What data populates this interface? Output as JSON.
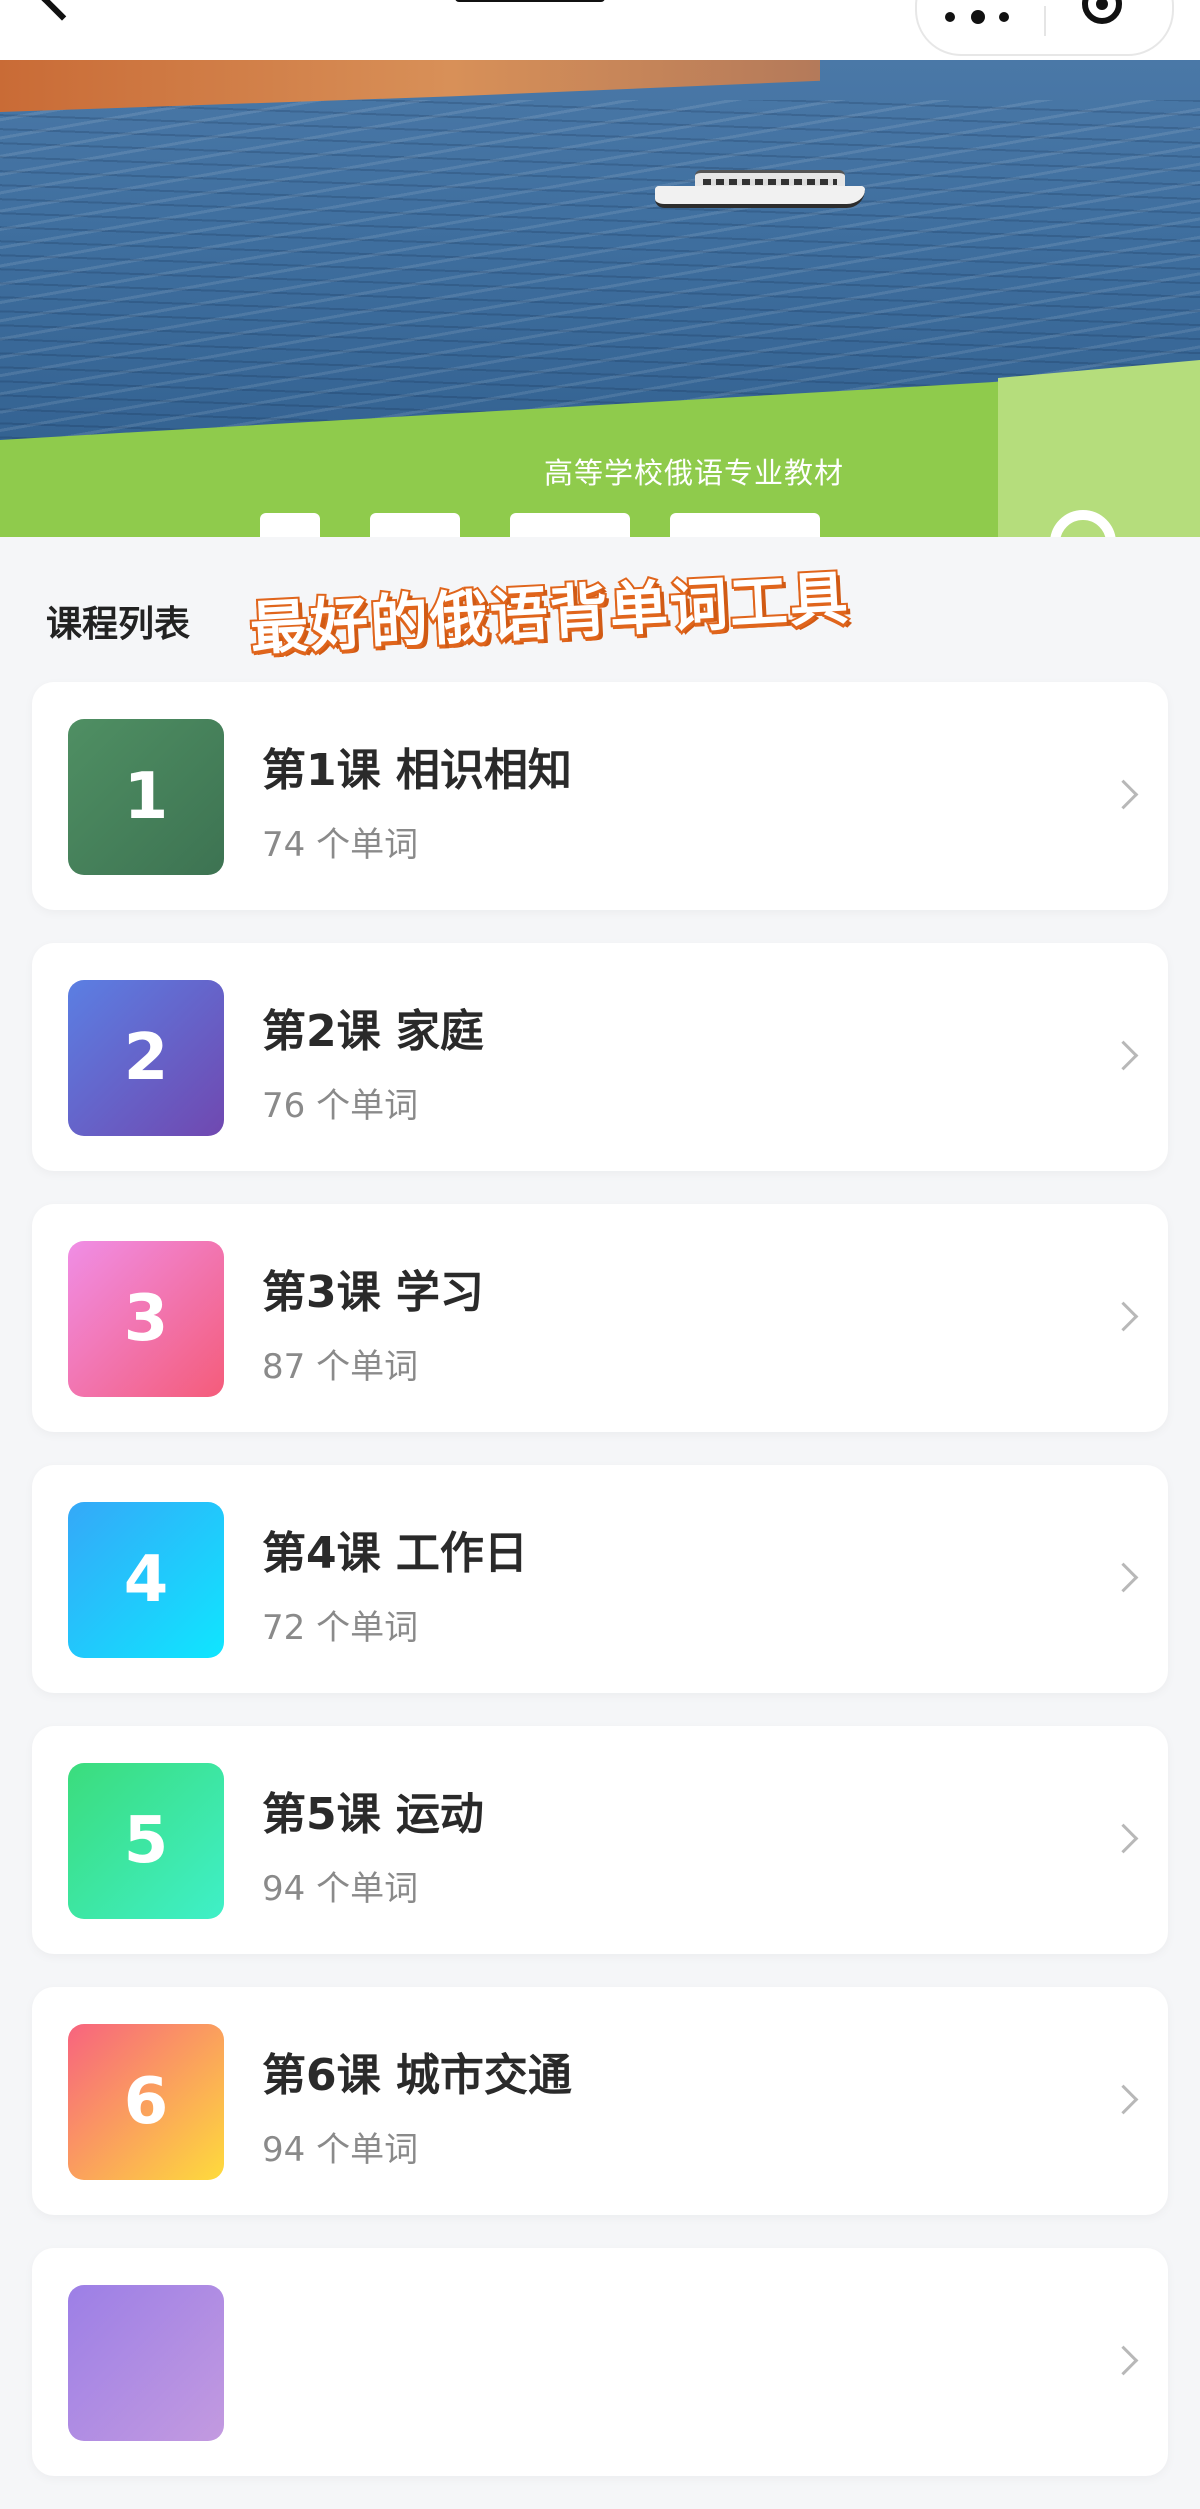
{
  "banner": {
    "subtitle": "高等学校俄语专业教材"
  },
  "section": {
    "title": "课程列表",
    "slogan": "最好的俄语背单词工具"
  },
  "courses": [
    {
      "number": "1",
      "title": "第1课  相识相知",
      "count": "74 个单词",
      "gradient": [
        "#4f8f63",
        "#3d7352"
      ]
    },
    {
      "number": "2",
      "title": "第2课  家庭",
      "count": "76 个单词",
      "gradient": [
        "#5b7fe3",
        "#7048b0"
      ]
    },
    {
      "number": "3",
      "title": "第3课  学习",
      "count": "87 个单词",
      "gradient": [
        "#f08ee6",
        "#f45c7a"
      ]
    },
    {
      "number": "4",
      "title": "第4课  工作日",
      "count": "72 个单词",
      "gradient": [
        "#35a8f8",
        "#0fe6ff"
      ]
    },
    {
      "number": "5",
      "title": "第5课  运动",
      "count": "94 个单词",
      "gradient": [
        "#3bdc7c",
        "#3ff0c8"
      ]
    },
    {
      "number": "6",
      "title": "第6课  城市交通",
      "count": "94 个单词",
      "gradient": [
        "#f7637f",
        "#fedb3c"
      ]
    },
    {
      "number": "",
      "title": "",
      "count": "",
      "gradient": [
        "#9c7fe6",
        "#c39ae0"
      ]
    }
  ],
  "icons": {
    "back": "back-icon",
    "more": "more-icon",
    "close": "close-mini-icon",
    "chevron": "chevron-right-icon"
  }
}
